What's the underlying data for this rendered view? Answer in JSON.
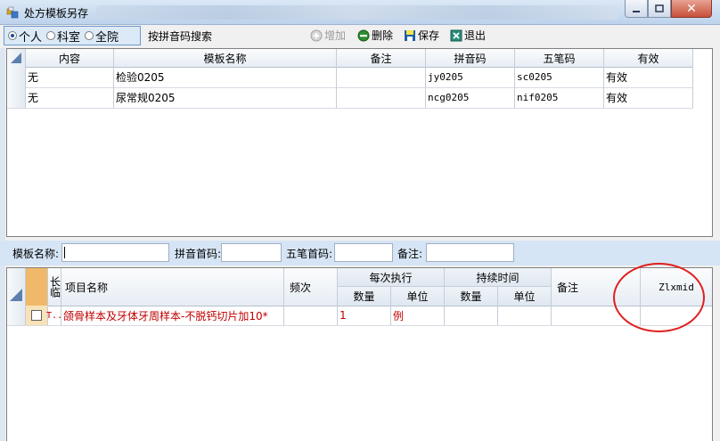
{
  "window": {
    "title": "处方模板另存",
    "min_label": "",
    "max_label": "",
    "close_label": "✕"
  },
  "toolbar": {
    "scope_options": [
      {
        "label": "个人",
        "selected": true
      },
      {
        "label": "科室",
        "selected": false
      },
      {
        "label": "全院",
        "selected": false
      }
    ],
    "pinyin_search_label": "按拼音码搜索",
    "add_label": "增加",
    "delete_label": "删除",
    "save_label": "保存",
    "exit_label": "退出"
  },
  "template_grid": {
    "columns": [
      "内容",
      "模板名称",
      "备注",
      "拼音码",
      "五笔码",
      "有效"
    ],
    "rows": [
      [
        "无",
        "检验0205",
        "",
        "jy0205",
        "sc0205",
        "有效"
      ],
      [
        "无",
        "尿常规0205",
        "",
        "ncg0205",
        "nif0205",
        "有效"
      ]
    ]
  },
  "filters": {
    "template_name_label": "模板名称:",
    "template_name_value": "",
    "pinyin_label": "拼音首码:",
    "pinyin_value": "",
    "wubi_label": "五笔首码:",
    "wubi_value": "",
    "remark_label": "备注:",
    "remark_value": ""
  },
  "item_grid": {
    "col_long": "长临",
    "col_name": "项目名称",
    "col_freq": "频次",
    "group_each": "每次执行",
    "group_duration": "持续时间",
    "col_qty": "数量",
    "col_unit": "单位",
    "col_qty2": "数量",
    "col_unit2": "单位",
    "col_remark": "备注",
    "col_zlxmid": "Zlxmid",
    "rows": [
      {
        "type": "T..",
        "name": "颌骨样本及牙体牙周样本-不脱钙切片加10*",
        "freq": "",
        "qty": "1",
        "unit": "例",
        "qty2": "",
        "unit2": "",
        "remark": "",
        "zlxmid": ""
      }
    ]
  }
}
